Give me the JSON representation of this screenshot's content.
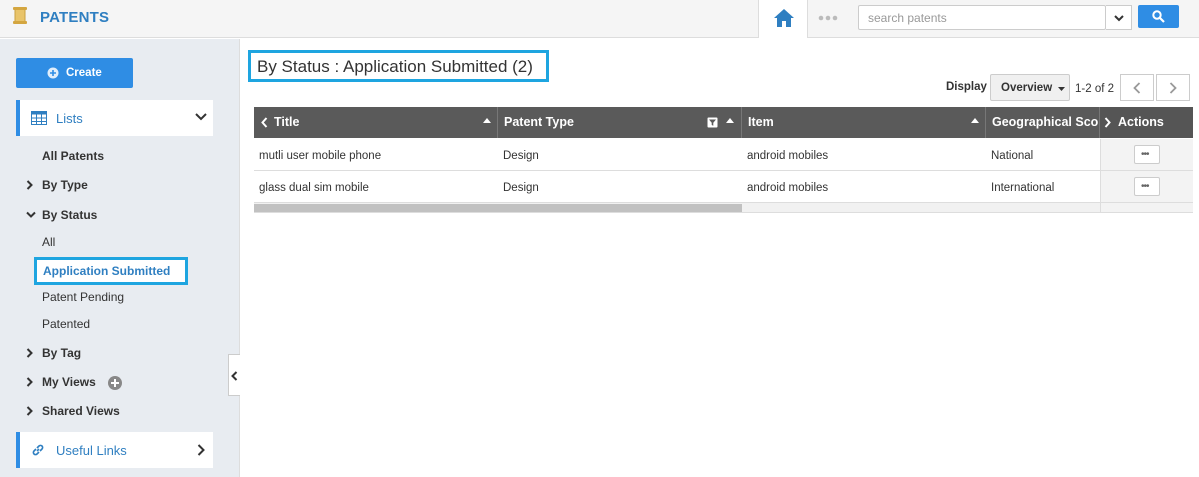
{
  "app": {
    "title": "PATENTS"
  },
  "search": {
    "placeholder": "search patents",
    "value": ""
  },
  "sidebar": {
    "create_label": "Create",
    "lists_label": "Lists",
    "items": {
      "all_patents": "All Patents",
      "by_type": "By Type",
      "by_status": "By Status",
      "all": "All",
      "application_submitted": "Application Submitted",
      "patent_pending": "Patent Pending",
      "patented": "Patented",
      "by_tag": "By Tag",
      "my_views": "My Views",
      "shared_views": "Shared Views"
    },
    "useful_links_label": "Useful Links"
  },
  "main": {
    "page_title": "By Status : Application Submitted (2)",
    "display_label": "Display",
    "display_value": "Overview",
    "pager_text": "1-2 of 2"
  },
  "table": {
    "columns": [
      "Title",
      "Patent Type",
      "Item",
      "Geographical Sco",
      "Actions"
    ],
    "rows": [
      {
        "title": "mutli user mobile phone",
        "patent_type": "Design",
        "item": "android mobiles",
        "geo": "National"
      },
      {
        "title": "glass dual sim mobile",
        "patent_type": "Design",
        "item": "android mobiles",
        "geo": "International"
      }
    ],
    "more_glyph": "•••"
  },
  "colors": {
    "accent": "#2f8de4",
    "highlight": "#1ea5e0",
    "header_bg": "#5a5a5a"
  }
}
